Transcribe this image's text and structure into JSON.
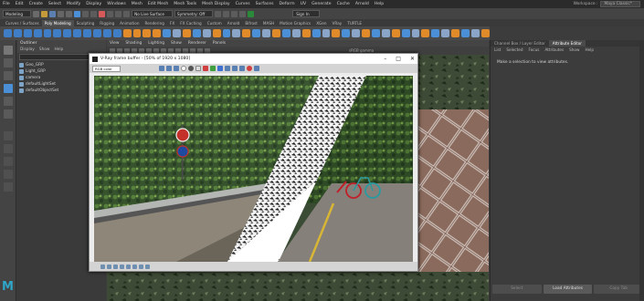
{
  "menubar": {
    "items": [
      "File",
      "Edit",
      "Create",
      "Select",
      "Modify",
      "Display",
      "Windows",
      "Mesh",
      "Edit Mesh",
      "Mesh Tools",
      "Mesh Display",
      "Curves",
      "Surfaces",
      "Deform",
      "UV",
      "Generate",
      "Cache",
      "Arnold",
      "Help"
    ],
    "workspace_label": "Workspace :",
    "workspace_value": "Maya Classic*"
  },
  "statusline": {
    "mode": "Modeling",
    "live_surface": "No Live Surface",
    "symmetry": "Symmetry: Off",
    "signin": "Sign In"
  },
  "shelf_tabs": [
    "Curves / Surfaces",
    "Poly Modeling",
    "Sculpting",
    "Rigging",
    "Animation",
    "Rendering",
    "FX",
    "FX Caching",
    "Custom",
    "Arnold",
    "Bifrost",
    "MASH",
    "Motion Graphics",
    "XGen",
    "VRay",
    "TURTLE"
  ],
  "shelf_active_index": 1,
  "outliner": {
    "title": "Outliner",
    "menu": [
      "Display",
      "Show",
      "Help"
    ],
    "items": [
      "Geo_GRP",
      "Light_GRP",
      "camera",
      "defaultLightSet",
      "defaultObjectSet"
    ]
  },
  "viewport": {
    "menu": [
      "View",
      "Shading",
      "Lighting",
      "Show",
      "Renderer",
      "Panels"
    ],
    "srgb": "sRGB gamma"
  },
  "vfb": {
    "title": "V-Ray frame buffer - [50% of 1920 x 1080]",
    "channel": "RGB color"
  },
  "rightpanel": {
    "tabs": [
      "Channel Box / Layer Editor",
      "Attribute Editor"
    ],
    "active_tab": 1,
    "menu": [
      "List",
      "Selected",
      "Focus",
      "Attributes",
      "Show",
      "Help"
    ],
    "message": "Make a selection to view attributes.",
    "buttons": [
      "Select",
      "Load Attributes",
      "Copy Tab"
    ]
  },
  "colors": {
    "accent_orange": "#e08a2a",
    "accent_blue": "#4b8fd6",
    "maya_logo": "#2fa6c9"
  },
  "icons": {
    "maya_logo": "M"
  }
}
